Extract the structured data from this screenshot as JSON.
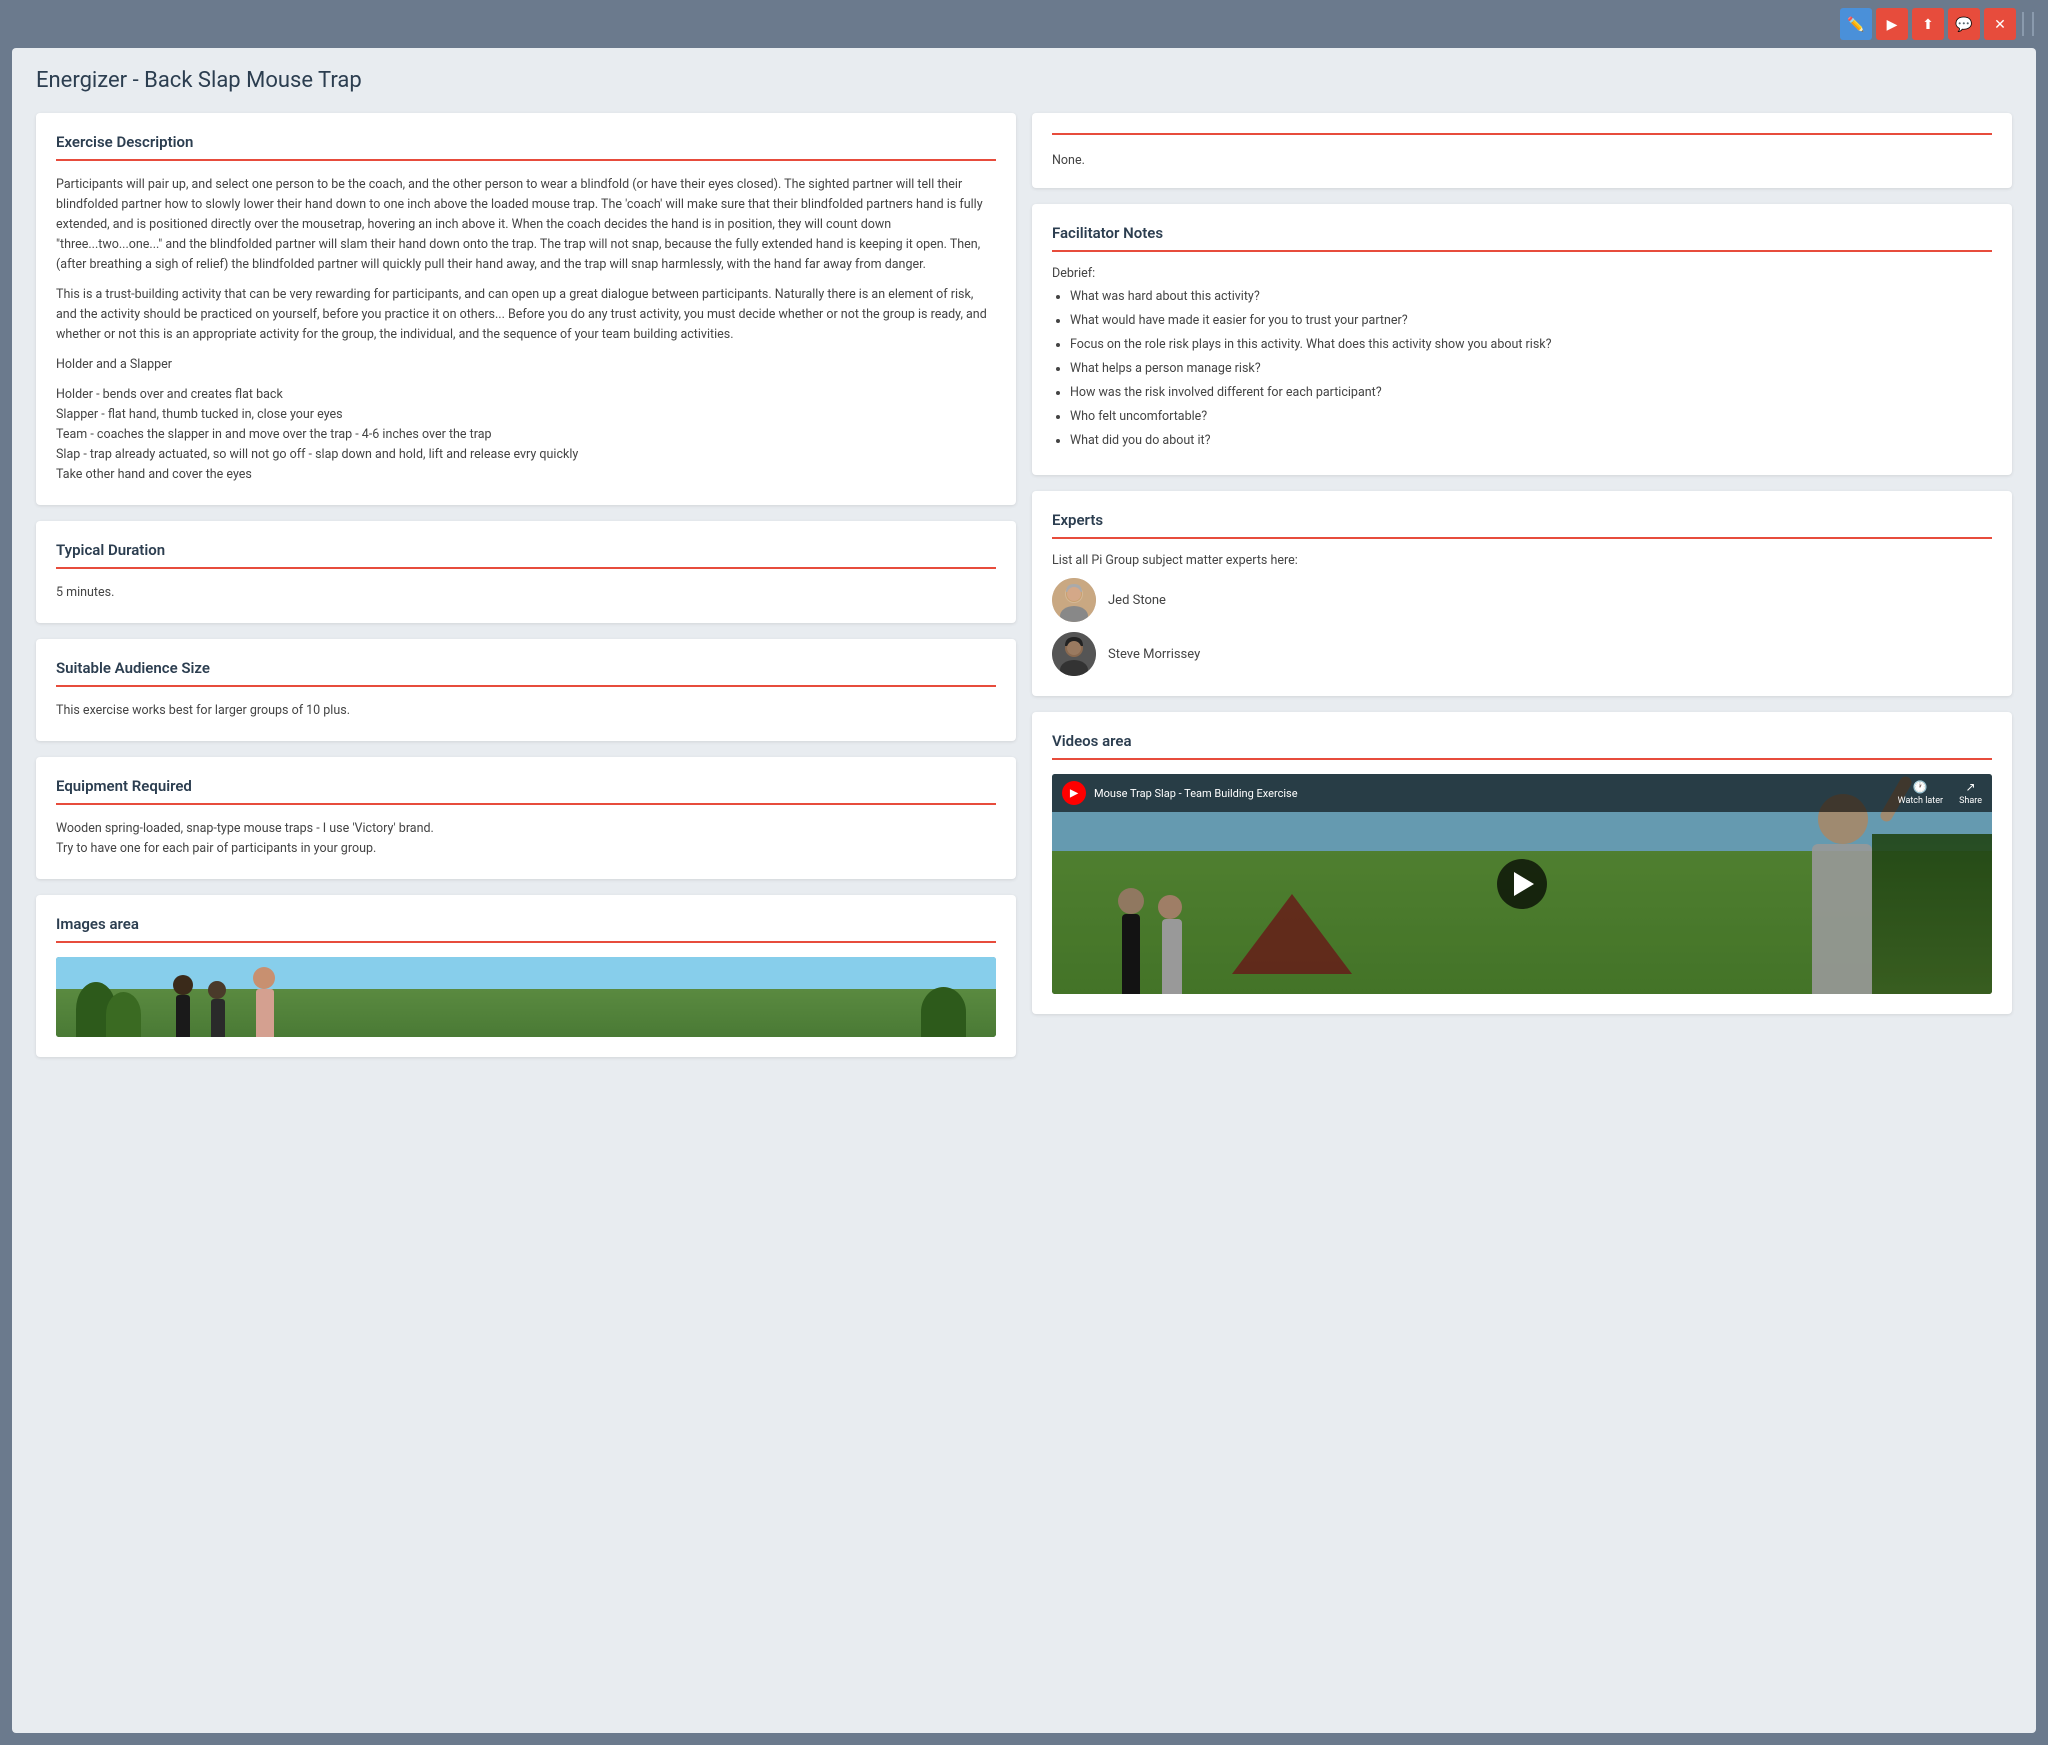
{
  "toolbar": {
    "buttons": [
      {
        "id": "edit",
        "icon": "✏️",
        "class": "btn-blue"
      },
      {
        "id": "play",
        "icon": "▶",
        "class": "btn-red-play"
      },
      {
        "id": "share",
        "icon": "⬆",
        "class": "btn-red-share"
      },
      {
        "id": "chat",
        "icon": "💬",
        "class": "btn-red-chat"
      },
      {
        "id": "close",
        "icon": "✕",
        "class": "btn-red-close"
      }
    ]
  },
  "page": {
    "title": "Energizer - Back Slap Mouse Trap"
  },
  "exercise_description": {
    "title": "Exercise Description",
    "paragraphs": [
      "Participants will pair up, and select one person to be the coach, and the other person to wear a blindfold (or have their eyes closed). The sighted partner will tell their blindfolded partner how to slowly lower their hand down to one inch above the loaded mouse trap. The 'coach' will make sure that their blindfolded partners hand is fully extended, and is positioned directly over the mousetrap, hovering an inch above it. When the coach decides the hand is in position, they will count down \"three...two...one...\" and the blindfolded partner will slam their hand down onto the trap. The trap will not snap, because the fully extended hand is keeping it open. Then, (after breathing a sigh of relief) the blindfolded partner will quickly pull their hand away, and the trap will snap harmlessly, with the hand far away from danger.",
      "This is a trust-building activity that can be very rewarding for participants, and can open up a great dialogue between participants. Naturally there is an element of risk, and the activity should be practiced on yourself, before you practice it on others... Before you do any trust activity, you must decide whether or not the group is ready, and whether or not this is an appropriate activity for the group, the individual, and the sequence of your team building activities.",
      "Holder and a Slapper",
      "Holder - bends over and creates flat back\nSlapper - flat hand, thumb tucked in, close your eyes\nTeam - coaches the slapper in and move over the trap - 4-6 inches over the trap\nSlap - trap already actuated, so will not go off - slap down and hold, lift and release evry quickly\nTake other hand and cover the eyes"
    ]
  },
  "typical_duration": {
    "title": "Typical Duration",
    "text": "5 minutes."
  },
  "audience_size": {
    "title": "Suitable Audience Size",
    "text": "This exercise works best for larger groups of 10 plus."
  },
  "equipment": {
    "title": "Equipment Required",
    "text": "Wooden spring-loaded, snap-type mouse traps - I use 'Victory' brand.\nTry to have one for each pair of participants in your group."
  },
  "images_area": {
    "title": "Images area"
  },
  "right_top": {
    "none_text": "None."
  },
  "facilitator_notes": {
    "title": "Facilitator Notes",
    "debrief_label": "Debrief:",
    "bullets": [
      "What was hard about this activity?",
      "What would have made it easier for you to trust your partner?",
      "Focus on the role risk plays in this activity. What does this activity show you about risk?",
      "What helps a person manage risk?",
      "How was the risk involved different for each participant?",
      "Who felt uncomfortable?",
      "What did you do about it?"
    ]
  },
  "experts": {
    "title": "Experts",
    "subtitle": "List all Pi Group subject matter experts here:",
    "list": [
      {
        "name": "Jed Stone"
      },
      {
        "name": "Steve Morrissey"
      }
    ]
  },
  "videos_area": {
    "title": "Videos area",
    "video_title": "Mouse Trap Slap - Team Building Exercise",
    "watch_later": "Watch later",
    "share": "Share"
  }
}
